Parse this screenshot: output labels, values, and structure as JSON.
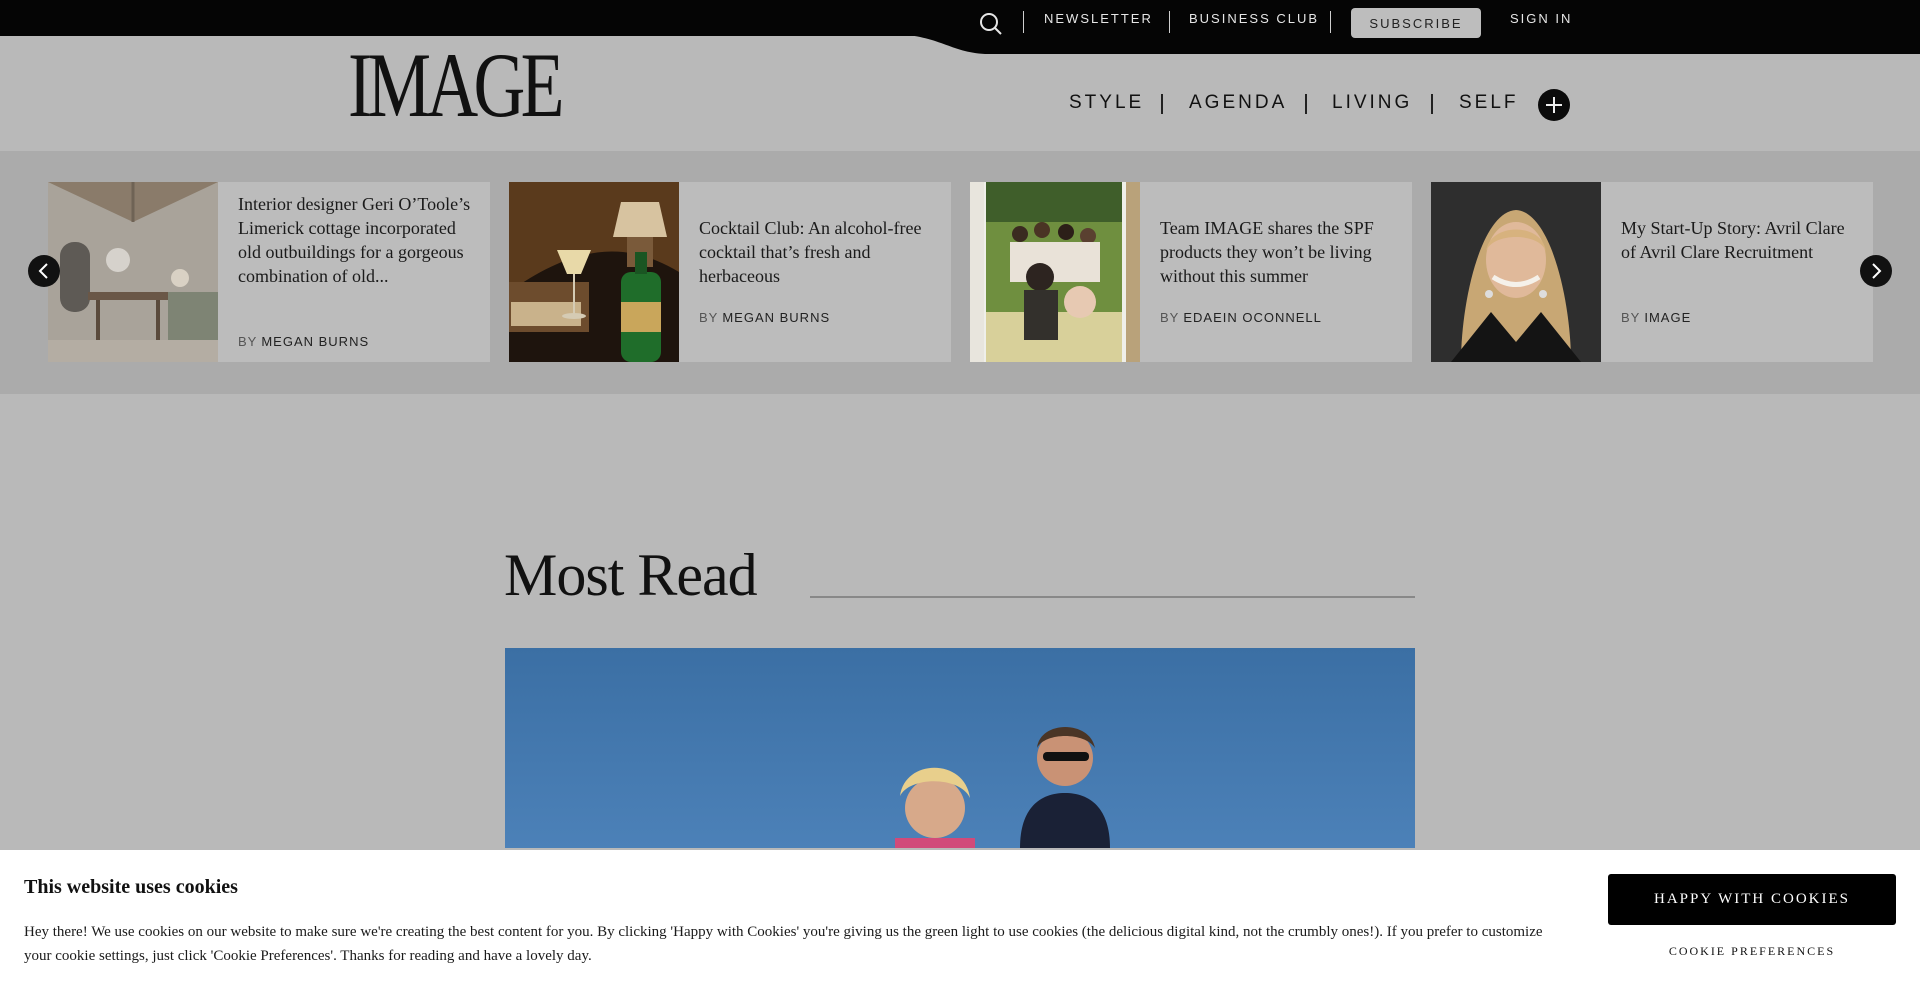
{
  "utility_nav": {
    "newsletter": "NEWSLETTER",
    "business_club": "BUSINESS CLUB",
    "subscribe": "SUBSCRIBE",
    "sign_in": "SIGN IN"
  },
  "header": {
    "logo": "IMAGE",
    "nav": [
      "STYLE",
      "AGENDA",
      "LIVING",
      "SELF"
    ]
  },
  "carousel": {
    "cards": [
      {
        "title": "Interior designer Geri O’Toole’s Limerick cottage incorporated old outbuildings for a gorgeous combination of old...",
        "by": "BY",
        "author": "MEGAN BURNS"
      },
      {
        "title": "Cocktail Club: An alcohol-free cocktail that’s fresh and herbaceous",
        "by": "BY",
        "author": "MEGAN BURNS"
      },
      {
        "title": "Team IMAGE shares the SPF products they won’t be living without this summer",
        "by": "BY",
        "author": "EDAEIN OCONNELL"
      },
      {
        "title": "My Start-Up Story: Avril Clare of Avril Clare Recruitment",
        "by": "BY",
        "author": "IMAGE"
      }
    ]
  },
  "most_read": {
    "title": "Most Read"
  },
  "cookie_banner": {
    "title": "This website uses cookies",
    "text": "Hey there! We use cookies on our website to make sure we're creating the best content for you. By clicking 'Happy with Cookies' you're giving us the green light to use cookies (the delicious digital kind, not the crumbly ones!). If you prefer to customize your cookie settings, just click 'Cookie Preferences'. Thanks for reading and have a lovely day.",
    "accept": "HAPPY WITH COOKIES",
    "preferences": "COOKIE PREFERENCES"
  }
}
